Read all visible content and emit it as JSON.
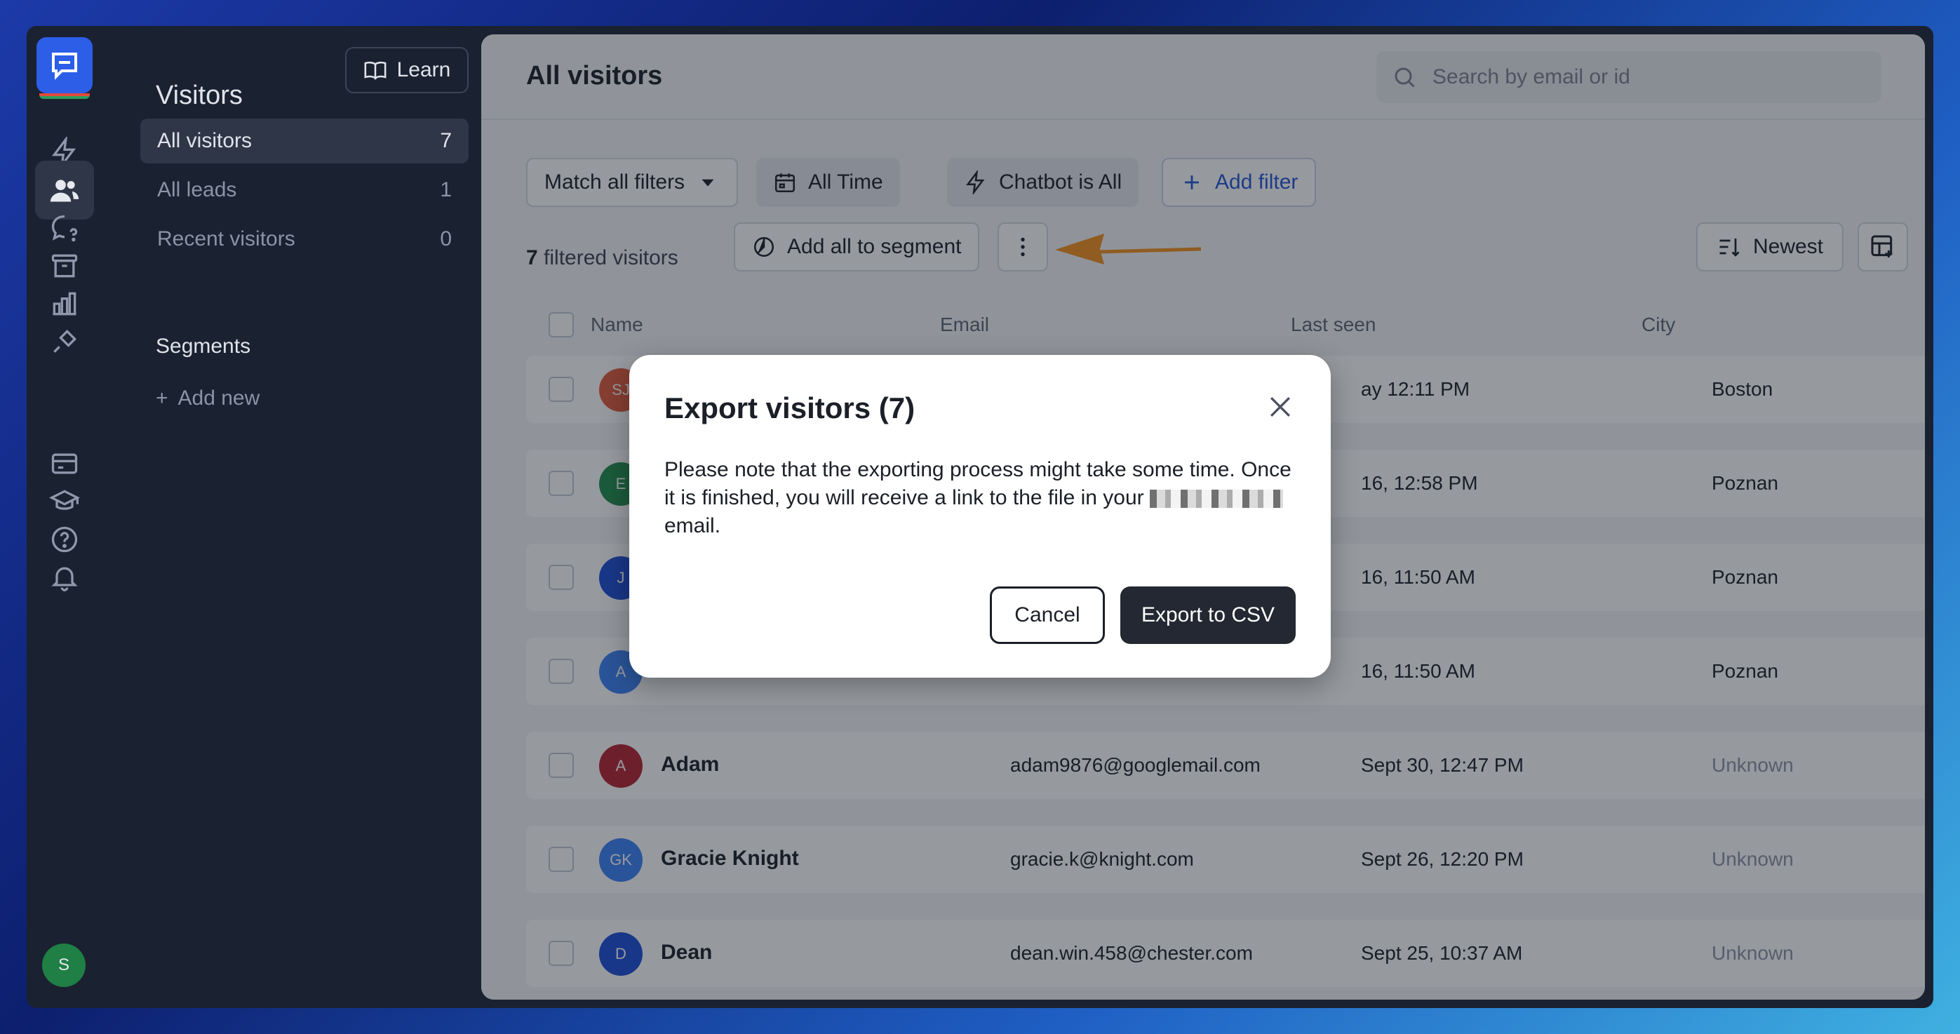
{
  "subnav": {
    "title": "Visitors",
    "learn_label": "Learn",
    "items": [
      {
        "label": "All visitors",
        "count": "7"
      },
      {
        "label": "All leads",
        "count": "1"
      },
      {
        "label": "Recent visitors",
        "count": "0"
      }
    ],
    "segments_title": "Segments",
    "add_new_label": "Add new"
  },
  "user_initial": "S",
  "main": {
    "title": "All visitors",
    "search_placeholder": "Search by email or id",
    "filters": {
      "match": "Match all filters",
      "time": "All Time",
      "chatbot_prefix": "Chatbot",
      "chatbot_is": "is",
      "chatbot_value": "All",
      "add_filter": "Add filter"
    },
    "filtered_count": "7",
    "filtered_suffix": "filtered visitors",
    "add_segment": "Add all to segment",
    "sort": "Newest",
    "columns": [
      "Name",
      "Email",
      "Last seen",
      "City"
    ],
    "rows": [
      {
        "initials": "SJ",
        "color": "#e2593b",
        "name": "",
        "email": "",
        "last_seen": "ay 12:11 PM",
        "city": "Boston",
        "city_muted": false
      },
      {
        "initials": "E",
        "color": "#1f8f4d",
        "name": "",
        "email": "",
        "last_seen": "16, 12:58 PM",
        "city": "Poznan",
        "city_muted": false
      },
      {
        "initials": "J",
        "color": "#1d4ed8",
        "name": "",
        "email": "",
        "last_seen": "16, 11:50 AM",
        "city": "Poznan",
        "city_muted": false
      },
      {
        "initials": "A",
        "color": "#3b82f6",
        "name": "",
        "email": "",
        "last_seen": "16, 11:50 AM",
        "city": "Poznan",
        "city_muted": false
      },
      {
        "initials": "A",
        "color": "#b42330",
        "name": "Adam",
        "email": "adam9876@googlemail.com",
        "last_seen": "Sept 30, 12:47 PM",
        "city": "Unknown",
        "city_muted": true
      },
      {
        "initials": "GK",
        "color": "#3b82f6",
        "name": "Gracie Knight",
        "email": "gracie.k@knight.com",
        "last_seen": "Sept 26, 12:20 PM",
        "city": "Unknown",
        "city_muted": true
      },
      {
        "initials": "D",
        "color": "#1d4ed8",
        "name": "Dean",
        "email": "dean.win.458@chester.com",
        "last_seen": "Sept 25, 10:37 AM",
        "city": "Unknown",
        "city_muted": true
      }
    ]
  },
  "modal": {
    "title": "Export visitors (7)",
    "body_start": "Please note that the exporting process might take some time. Once it is finished, you will receive a link to the file in your",
    "body_end": "email.",
    "cancel": "Cancel",
    "export": "Export to CSV"
  },
  "colors": {
    "accent": "#2456d6",
    "arrow": "#f5901e",
    "brand": "#2d5ee8"
  }
}
